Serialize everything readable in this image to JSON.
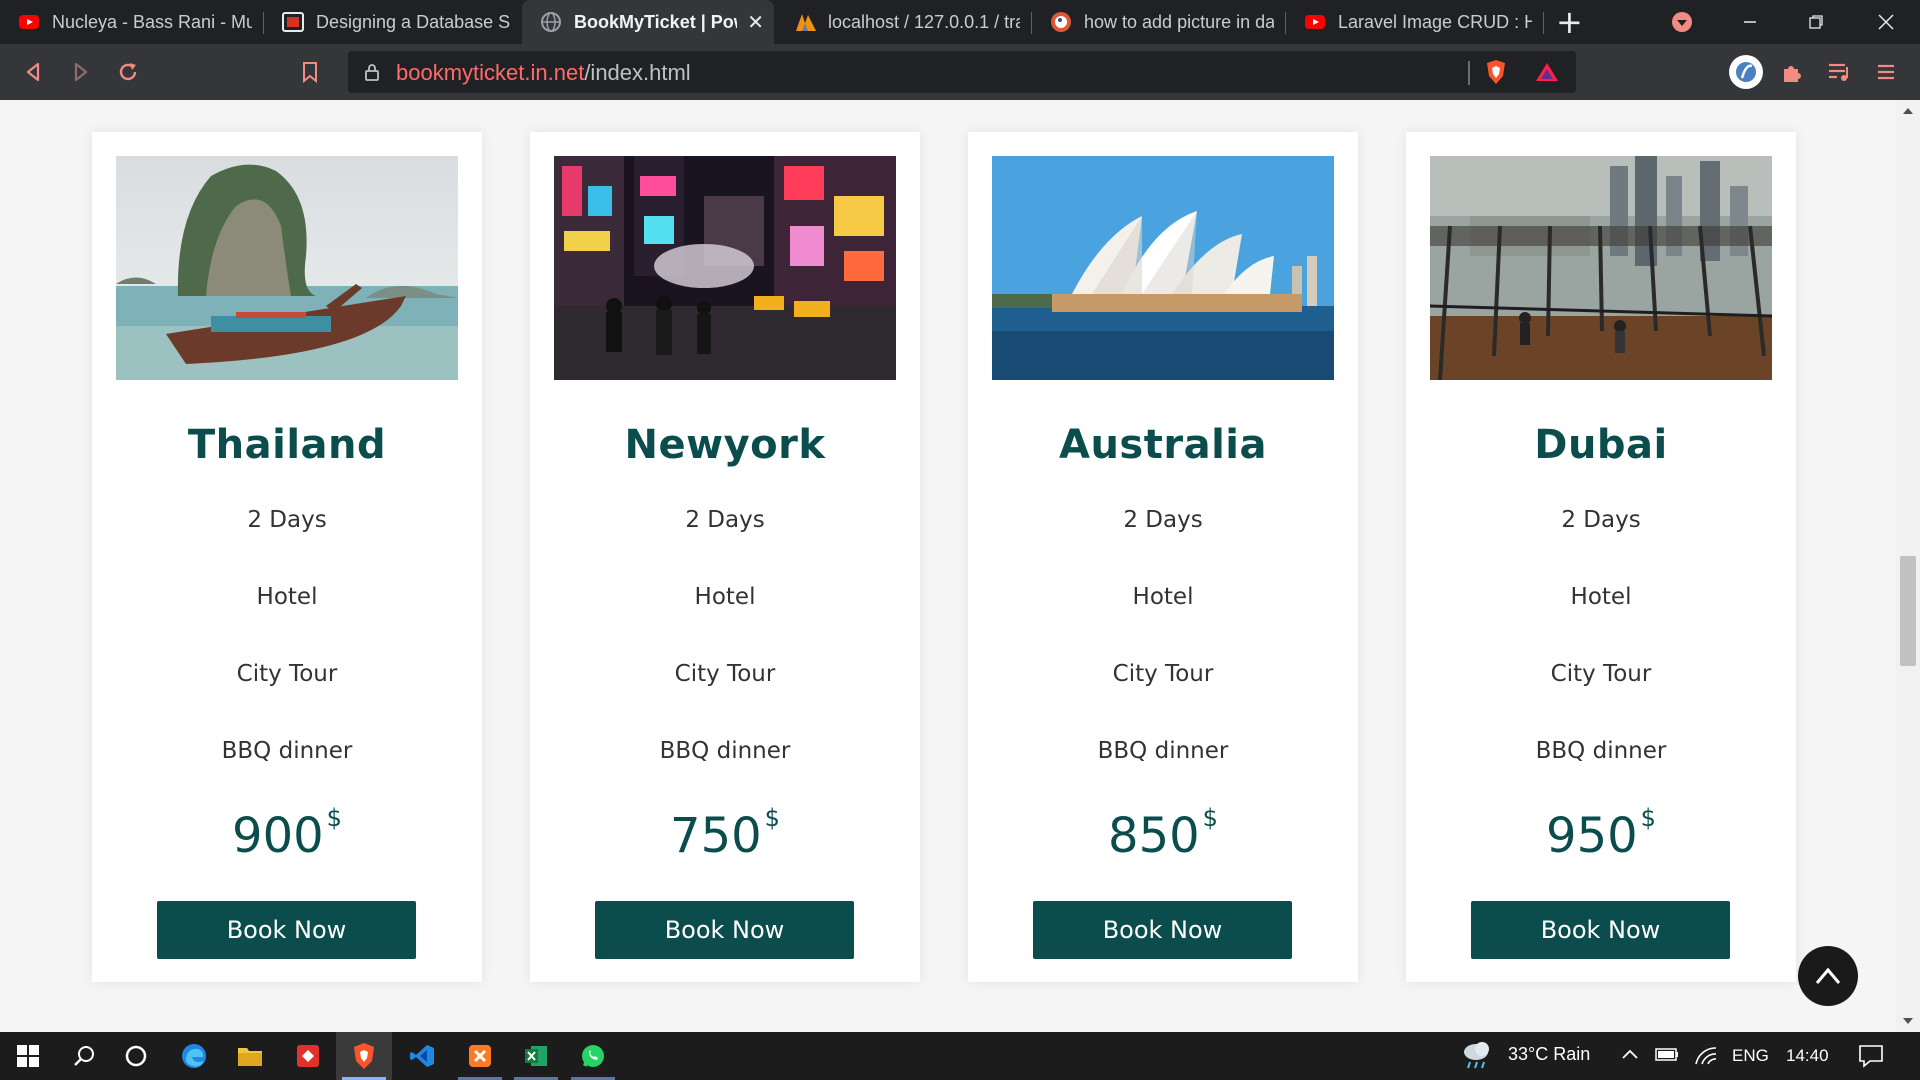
{
  "browser": {
    "tabs": [
      {
        "label": "Nucleya - Bass Rani - Mu",
        "icon": "youtube-icon"
      },
      {
        "label": "Designing a Database Sy",
        "icon": "slides-icon"
      },
      {
        "label": "BookMyTicket | Powe",
        "icon": "globe-icon",
        "active": true
      },
      {
        "label": "localhost / 127.0.0.1 / tra",
        "icon": "phpmyadmin-icon"
      },
      {
        "label": "how to add picture in da",
        "icon": "duckduckgo-icon"
      },
      {
        "label": "Laravel Image CRUD : Ho",
        "icon": "youtube-icon"
      }
    ],
    "url_host": "bookmyticket.in.net",
    "url_path": "/index.html"
  },
  "packages": [
    {
      "destination": "Thailand",
      "features": [
        "2 Days",
        "Hotel",
        "City Tour",
        "BBQ dinner"
      ],
      "price": "900",
      "currency": "$",
      "button": "Book Now",
      "image": "thailand-longtail-boat-cliff"
    },
    {
      "destination": "Newyork",
      "features": [
        "2 Days",
        "Hotel",
        "City Tour",
        "BBQ dinner"
      ],
      "price": "750",
      "currency": "$",
      "button": "Book Now",
      "image": "times-square-night"
    },
    {
      "destination": "Australia",
      "features": [
        "2 Days",
        "Hotel",
        "City Tour",
        "BBQ dinner"
      ],
      "price": "850",
      "currency": "$",
      "button": "Book Now",
      "image": "sydney-opera-house"
    },
    {
      "destination": "Dubai",
      "features": [
        "2 Days",
        "Hotel",
        "City Tour",
        "BBQ dinner"
      ],
      "price": "950",
      "currency": "$",
      "button": "Book Now",
      "image": "dubai-observation-deck"
    }
  ],
  "taskbar": {
    "weather": "33°C  Rain",
    "language": "ENG",
    "time": "14:40"
  },
  "colors": {
    "brand": "#0b4d4d",
    "tab_bar": "#202124",
    "toolbar": "#35363a",
    "url_host": "#ff6b6b"
  }
}
